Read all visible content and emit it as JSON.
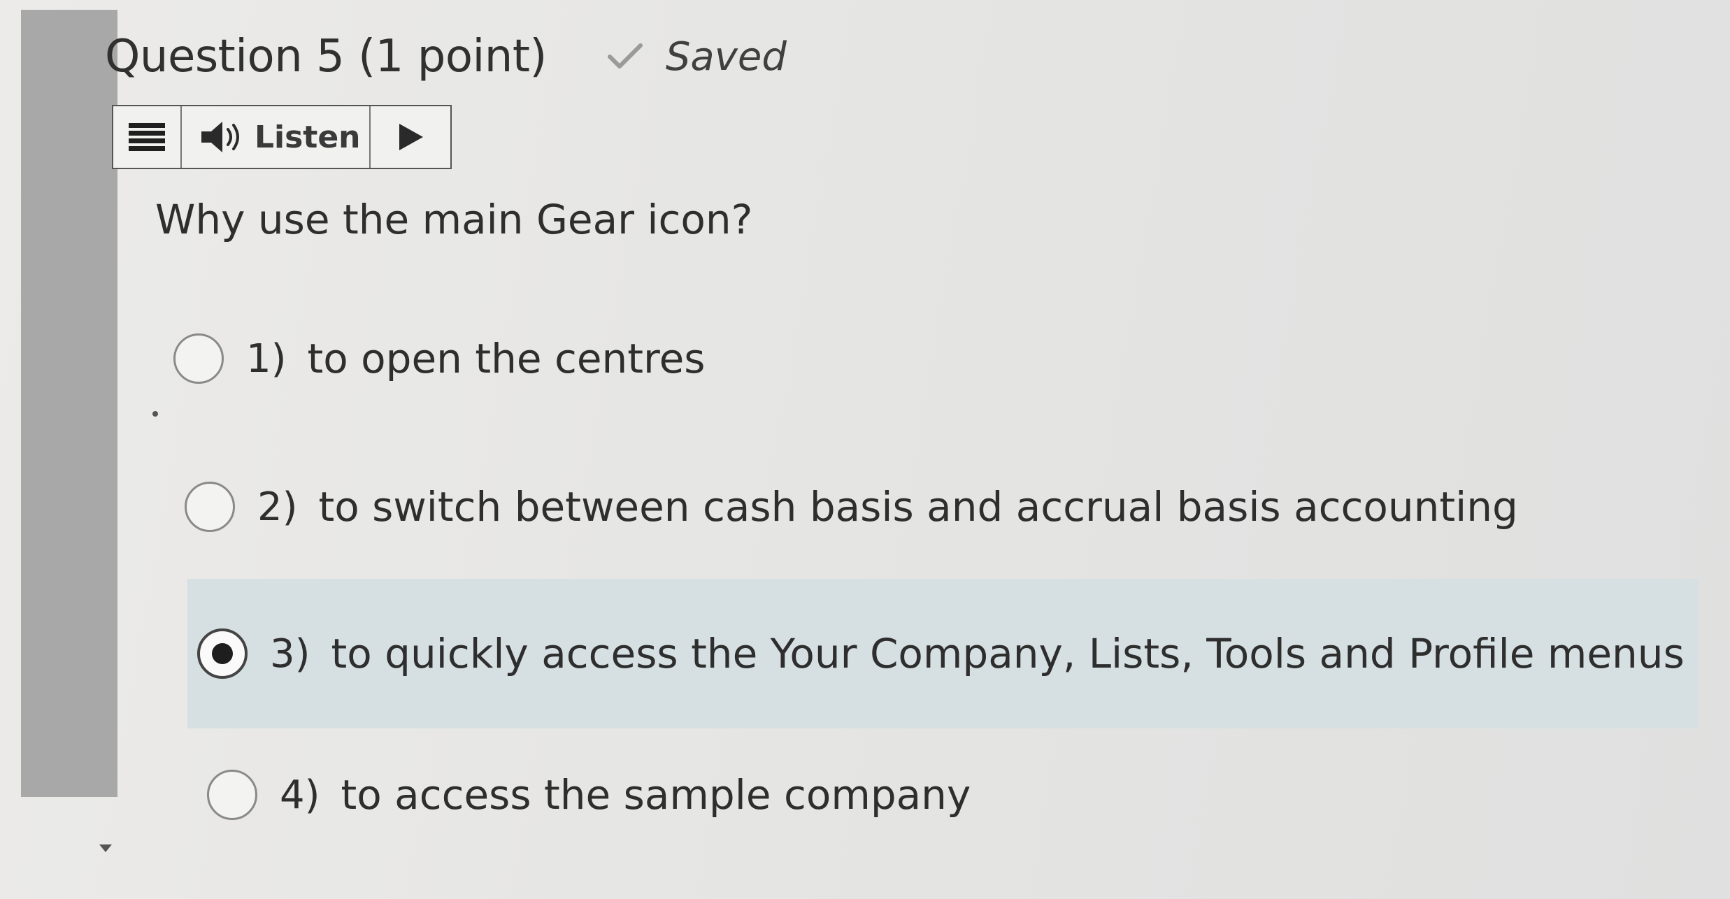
{
  "question": {
    "title": "Question 5 (1 point)",
    "status": "Saved",
    "status_icon": "checkmark-icon",
    "text": "Why use the main Gear icon?"
  },
  "toolbar": {
    "menu_icon": "menu-icon",
    "speaker_icon": "speaker-icon",
    "listen_label": "Listen",
    "play_icon": "play-icon"
  },
  "options": [
    {
      "number": "1)",
      "text": "to open the centres",
      "selected": false
    },
    {
      "number": "2)",
      "text": "to switch between cash basis and accrual basis accounting",
      "selected": false
    },
    {
      "number": "3)",
      "text": "to quickly access the Your Company, Lists, Tools and Profile menus",
      "selected": true
    },
    {
      "number": "4)",
      "text": "to access the sample company",
      "selected": false
    }
  ],
  "colors": {
    "selected_background": "#d6e0e2",
    "left_bar": "#a7a8a7"
  }
}
